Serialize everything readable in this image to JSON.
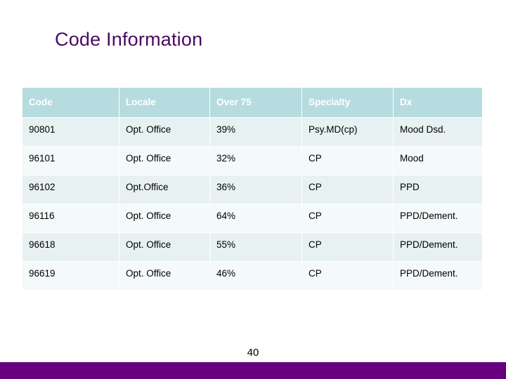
{
  "slide": {
    "title": "Code Information",
    "page_number": "40",
    "title_color": "#4b0a63",
    "accent_bar_color": "#66007f",
    "header_bg_color": "#b6dce0",
    "row_odd_bg_color": "#e8f1f2",
    "row_even_bg_color": "#f4f9fa"
  },
  "table": {
    "columns": [
      "Code",
      "Locale",
      "Over 75",
      "Specialty",
      "Dx"
    ],
    "rows": [
      {
        "code": "90801",
        "locale": "Opt. Office",
        "over75": "39%",
        "specialty": "Psy.MD(cp)",
        "dx": "Mood Dsd."
      },
      {
        "code": "96101",
        "locale": "Opt. Office",
        "over75": "32%",
        "specialty": "CP",
        "dx": "Mood"
      },
      {
        "code": "96102",
        "locale": "Opt.Office",
        "over75": "36%",
        "specialty": "CP",
        "dx": "PPD"
      },
      {
        "code": "96116",
        "locale": "Opt. Office",
        "over75": "64%",
        "specialty": "CP",
        "dx": "PPD/Dement."
      },
      {
        "code": "96618",
        "locale": "Opt. Office",
        "over75": "55%",
        "specialty": "CP",
        "dx": "PPD/Dement."
      },
      {
        "code": "96619",
        "locale": "Opt. Office",
        "over75": "46%",
        "specialty": "CP",
        "dx": "PPD/Dement."
      }
    ]
  }
}
